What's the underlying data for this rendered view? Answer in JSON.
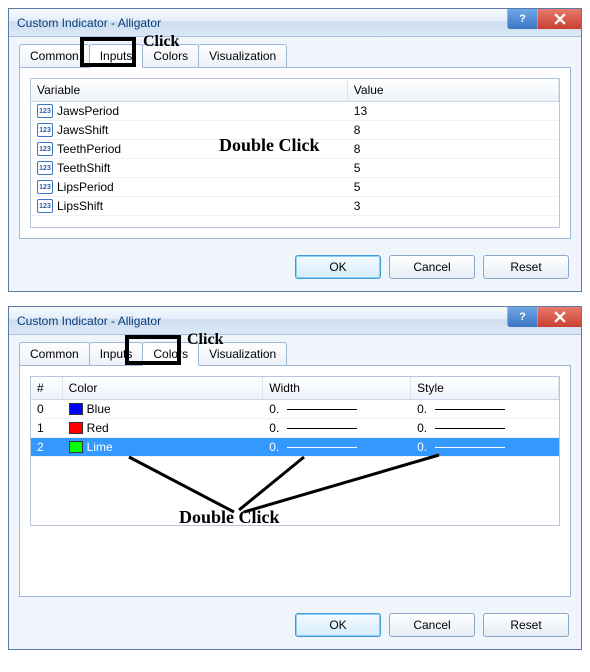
{
  "window1": {
    "title": "Custom Indicator - Alligator",
    "tabs": [
      "Common",
      "Inputs",
      "Colors",
      "Visualization"
    ],
    "active_tab": 1,
    "columns": {
      "variable": "Variable",
      "value": "Value"
    },
    "rows": [
      {
        "name": "JawsPeriod",
        "value": "13"
      },
      {
        "name": "JawsShift",
        "value": "8"
      },
      {
        "name": "TeethPeriod",
        "value": "8"
      },
      {
        "name": "TeethShift",
        "value": "5"
      },
      {
        "name": "LipsPeriod",
        "value": "5"
      },
      {
        "name": "LipsShift",
        "value": "3"
      }
    ],
    "buttons": {
      "ok": "OK",
      "cancel": "Cancel",
      "reset": "Reset"
    },
    "annotations": {
      "click": "Click",
      "double_click": "Double Click"
    }
  },
  "window2": {
    "title": "Custom Indicator - Alligator",
    "tabs": [
      "Common",
      "Inputs",
      "Colors",
      "Visualization"
    ],
    "active_tab": 2,
    "columns": {
      "n": "#",
      "color": "Color",
      "width": "Width",
      "style": "Style"
    },
    "rows": [
      {
        "n": "0",
        "color_name": "Blue",
        "color_hex": "#0000ff",
        "width": "0.",
        "style": "0."
      },
      {
        "n": "1",
        "color_name": "Red",
        "color_hex": "#ff0000",
        "width": "0.",
        "style": "0."
      },
      {
        "n": "2",
        "color_name": "Lime",
        "color_hex": "#00ff00",
        "width": "0.",
        "style": "0.",
        "selected": true
      }
    ],
    "buttons": {
      "ok": "OK",
      "cancel": "Cancel",
      "reset": "Reset"
    },
    "annotations": {
      "click": "Click",
      "double_click": "Double Click"
    }
  },
  "icons": {
    "int_badge": "123",
    "help": "?",
    "close": "×"
  }
}
